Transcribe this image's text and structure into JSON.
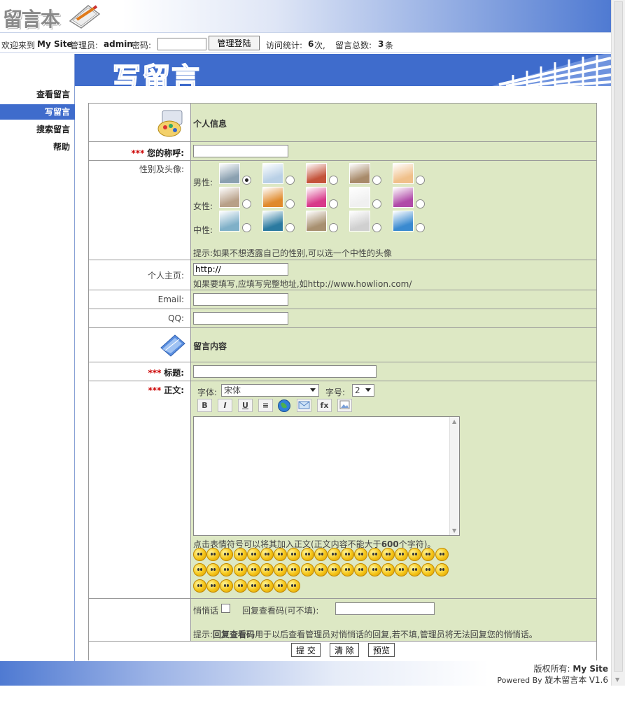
{
  "header": {
    "logo_text": "留言本"
  },
  "topbar": {
    "welcome": "欢迎来到",
    "site_name": "My Site",
    "admin_label": "管理员:",
    "admin_name": "admin",
    "password_label": "密码:",
    "login_button": "管理登陆",
    "visits_label": "访问统计:",
    "visits_count": "6",
    "visits_unit": "次,",
    "total_label": "留言总数:",
    "total_count": "3",
    "total_unit": "条"
  },
  "banner": {
    "title": "写留言"
  },
  "sidebar": {
    "items": [
      {
        "label": "查看留言"
      },
      {
        "label": "写留言"
      },
      {
        "label": "搜索留言"
      },
      {
        "label": "帮助"
      }
    ]
  },
  "form": {
    "personal_section": "个人信息",
    "required_mark": "***",
    "nickname_label": "您的称呼:",
    "gender_avatar_label": "性别及头像:",
    "male_label": "男性:",
    "female_label": "女性:",
    "neutral_label": "中性:",
    "avatar_hint": "提示:如果不想透露自己的性别,可以选一个中性的头像",
    "homepage_label": "个人主页:",
    "homepage_value": "http://",
    "homepage_hint": "如果要填写,应填写完整地址,如http://www.howlion.com/",
    "email_label": "Email:",
    "qq_label": "QQ:",
    "content_section": "留言内容",
    "subject_label": "标题:",
    "body_label": "正文:",
    "font_label": "字体:",
    "font_value": "宋体",
    "size_label": "字号:",
    "size_value": "2",
    "toolbar": [
      "B",
      "I",
      "U",
      "≡",
      "globe",
      "mail",
      "fx",
      "img"
    ],
    "emoticon_hint_pre": "点击表情符号可以将其加入正文(正文内容不能大于",
    "emoticon_hint_num": "600",
    "emoticon_hint_post": "个字符)。",
    "whisper_label": "悄悄话",
    "reply_code_label": "回复查看码(可不填):",
    "reply_hint_pre": "提示:",
    "reply_hint_bold": "回复查看码",
    "reply_hint_post": "用于以后查看管理员对悄悄话的回复,若不填,管理员将无法回复您的悄悄话。",
    "submit_button": "提 交",
    "clear_button": "清 除",
    "preview_button": "预览"
  },
  "footer": {
    "copyright_label": "版权所有:",
    "copyright_site": "My Site",
    "powered_label": "Powered By",
    "powered_product": "旋木留言本",
    "version": "V1.6"
  },
  "colors": {
    "blue": "#3f6ccc",
    "form_bg": "#dde8c4",
    "required": "#cc0000"
  }
}
